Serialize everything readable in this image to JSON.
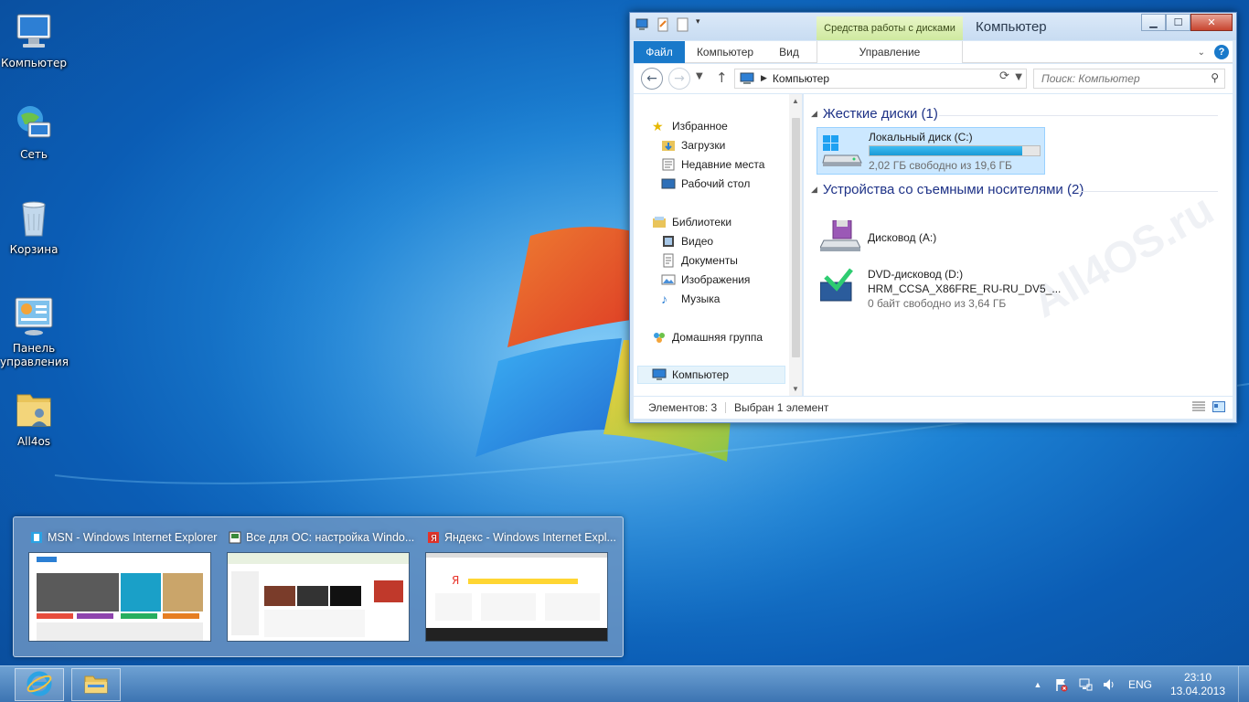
{
  "desktop": {
    "icons": [
      {
        "label": "Компьютер",
        "icon": "computer-icon"
      },
      {
        "label": "Сеть",
        "icon": "network-icon"
      },
      {
        "label": "Корзина",
        "icon": "recycle-bin-icon"
      },
      {
        "label": "Панель управления",
        "icon": "control-panel-icon"
      },
      {
        "label": "All4os",
        "icon": "user-folder-icon"
      }
    ]
  },
  "explorer": {
    "title": "Компьютер",
    "contextual_tab": "Средства работы с дисками",
    "tabs": {
      "file": "Файл",
      "computer": "Компьютер",
      "view": "Вид",
      "manage": "Управление"
    },
    "address": {
      "path": "Компьютер"
    },
    "search": {
      "placeholder": "Поиск: Компьютер"
    },
    "nav_pane": {
      "favorites": "Избранное",
      "downloads": "Загрузки",
      "recent": "Недавние места",
      "desktop": "Рабочий стол",
      "libraries": "Библиотеки",
      "video": "Видео",
      "documents": "Документы",
      "pictures": "Изображения",
      "music": "Музыка",
      "homegroup": "Домашняя группа",
      "computer": "Компьютер"
    },
    "groups": {
      "hard_drives": "Жесткие диски (1)",
      "removable": "Устройства со съемными носителями (2)"
    },
    "drives": {
      "c": {
        "name": "Локальный диск (C:)",
        "free": "2,02 ГБ свободно из 19,6 ГБ",
        "used_fraction": 0.897
      }
    },
    "devices": {
      "floppy": {
        "name": "Дисковод (A:)"
      },
      "dvd": {
        "name": "DVD-дисковод (D:)",
        "label": "HRM_CCSA_X86FRE_RU-RU_DV5_...",
        "free": "0 байт свободно из 3,64 ГБ"
      }
    },
    "status": {
      "count": "Элементов: 3",
      "selected": "Выбран 1 элемент"
    },
    "watermark": "All4OS.ru"
  },
  "thumbnails": [
    {
      "title": "MSN - Windows Internet Explorer",
      "icon": "ie-page-icon"
    },
    {
      "title": "Все для ОС: настройка Windo...",
      "icon": "ie-page-icon"
    },
    {
      "title": "Яндекс - Windows Internet Expl...",
      "icon": "yandex-icon"
    }
  ],
  "taskbar": {
    "apps": [
      {
        "icon": "internet-explorer-icon"
      },
      {
        "icon": "file-explorer-icon"
      }
    ],
    "tray": {
      "language": "ENG",
      "time": "23:10",
      "date": "13.04.2013"
    }
  },
  "colors": {
    "accent": "#1979ca",
    "contextual_tab": "#cfe9a0",
    "selection": "#cce8ff",
    "disk_bar": "#1a9ad5"
  }
}
